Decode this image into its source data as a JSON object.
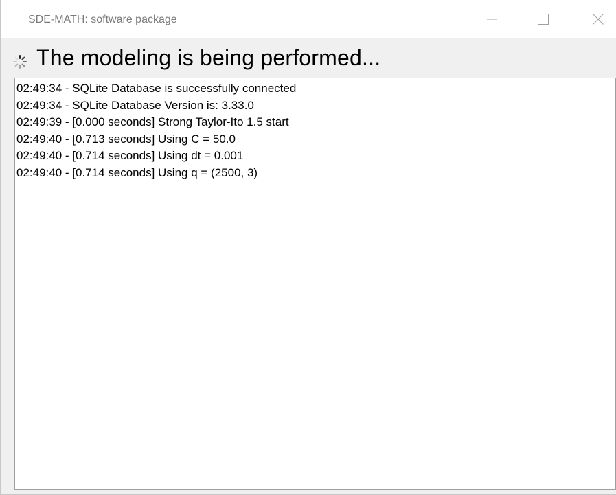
{
  "window": {
    "title": "SDE-MATH: software package",
    "controls": {
      "minimize_icon": "minimize-icon",
      "maximize_icon": "maximize-icon",
      "close_icon": "close-icon"
    }
  },
  "header": {
    "spinner_icon": "loading-spinner-icon",
    "status_text": "The modeling is being performed..."
  },
  "log": {
    "lines": [
      "02:49:34 - SQLite Database is successfully connected",
      "02:49:34 - SQLite Database Version is: 3.33.0",
      "02:49:39 - [0.000 seconds] Strong Taylor-Ito 1.5 start",
      "02:49:40 - [0.713 seconds] Using C = 50.0",
      "02:49:40 - [0.714 seconds] Using dt = 0.001",
      "02:49:40 - [0.714 seconds] Using q = (2500, 3)"
    ]
  },
  "colors": {
    "title_text": "#7a7a7a",
    "background": "#f0f0f0",
    "log_border": "#a0a0a0"
  }
}
